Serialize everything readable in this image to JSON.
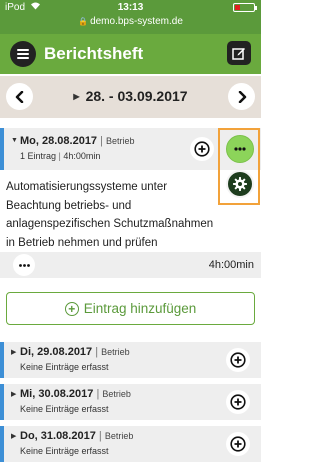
{
  "status_bar": {
    "carrier": "iPod",
    "time": "13:13",
    "url": "demo.bps-system.de"
  },
  "header": {
    "title": "Berichtsheft"
  },
  "week_nav": {
    "label": "28. - 03.09.2017"
  },
  "expanded_day": {
    "title": "Mo, 28.08.2017",
    "type": "Betrieb",
    "entries_count": "1 Eintrag",
    "total_duration": "4h:00min",
    "entry": {
      "text": "Automatisierungssysteme unter Beachtung betriebs- und anlagenspezifischen Schutzmaßnahmen in Betrieb nehmen und prüfen",
      "duration": "4h:00min"
    }
  },
  "add_entry": {
    "label": "Eintrag hinzufügen"
  },
  "days": [
    {
      "title": "Di, 29.08.2017",
      "type": "Betrieb",
      "status": "Keine Einträge erfasst"
    },
    {
      "title": "Mi, 30.08.2017",
      "type": "Betrieb",
      "status": "Keine Einträge erfasst"
    },
    {
      "title": "Do, 31.08.2017",
      "type": "Betrieb",
      "status": "Keine Einträge erfasst"
    }
  ],
  "colors": {
    "header_green": "#6aaa3e",
    "statusbar_green": "#5b9a3b",
    "day_accent_blue": "#3d8fd6",
    "highlight_orange": "#f2a23a",
    "fab_light_green": "#8cd45a",
    "fab_dark_green": "#1e3d1e"
  },
  "icons": {
    "menu": "menu-icon",
    "edit": "edit-icon",
    "prev": "chevron-left-icon",
    "next": "chevron-right-icon",
    "add": "plus-circle-icon",
    "more": "more-dots-icon",
    "settings": "gear-icon"
  }
}
